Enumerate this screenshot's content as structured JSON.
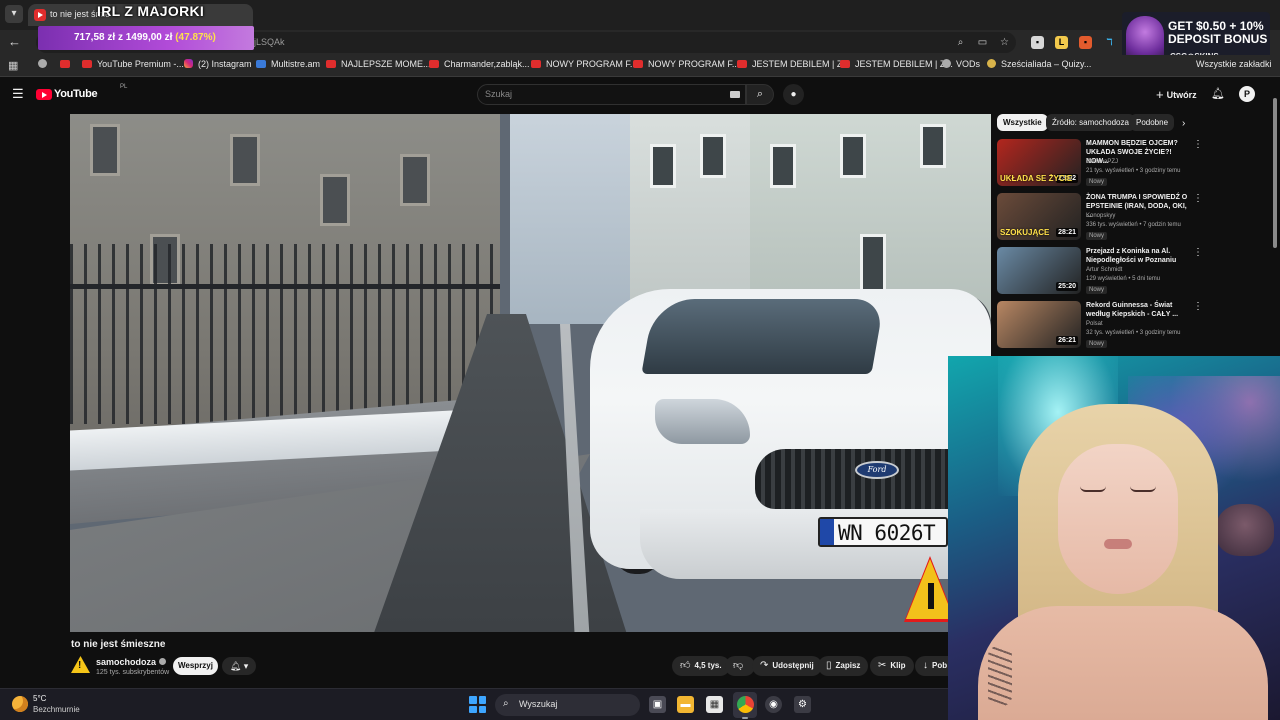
{
  "browser": {
    "tab_title": "to nie jest śmie",
    "url": "jLSQAk",
    "bookmarks": [
      {
        "label": "",
        "icon": "youtube-icon"
      },
      {
        "label": "YouTube Premium -...",
        "icon": "youtube-icon"
      },
      {
        "label": "(2) Instagram",
        "icon": "instagram-icon"
      },
      {
        "label": "Multistre.am",
        "icon": "multistream-icon"
      },
      {
        "label": "NAJLEPSZE MOME...",
        "icon": "youtube-icon"
      },
      {
        "label": "Charmander,zabląk...",
        "icon": "youtube-icon"
      },
      {
        "label": "NOWY PROGRAM F...",
        "icon": "youtube-icon"
      },
      {
        "label": "NOWY PROGRAM F...",
        "icon": "youtube-icon"
      },
      {
        "label": "JESTEM DEBILEM | Z...",
        "icon": "youtube-icon"
      },
      {
        "label": "JESTEM DEBILEM | Z...",
        "icon": "youtube-icon"
      },
      {
        "label": "VODs",
        "icon": "chrome-icon"
      },
      {
        "label": "Sześcialiada – Quizy...",
        "icon": "user-icon"
      }
    ],
    "bookmarks_folder": "Wszystkie zakładki"
  },
  "stream_overlay": {
    "title": "IRL Z MAJORKI",
    "donation_amount": "717,58 zł",
    "donation_of": "z",
    "donation_goal": "1499,00 zł",
    "donation_percent": "(47.87%)",
    "promo_line1": "GET $0.50 + 10%",
    "promo_line2": "DEPOSIT BONUS",
    "promo_brand": "CSG◎SKINS"
  },
  "youtube": {
    "logo_text": "YouTube",
    "logo_country": "PL",
    "search_placeholder": "Szukaj",
    "create_label": "Utwórz",
    "avatar_letter": "P",
    "video_title": "to nie jest śmieszne",
    "plate_text": "WN 6026T",
    "channel_name": "samochodoza",
    "channel_subs": "125 tys. subskrybentów",
    "join_label": "Wesprzyj",
    "actions": {
      "likes": "4,5 tys.",
      "share": "Udostępnij",
      "save": "Zapisz",
      "clip": "Klip",
      "download": "Pob"
    },
    "chips": [
      "Wszystkie",
      "Źródło: samochodoza",
      "Podobne"
    ],
    "recommendations": [
      {
        "title": "MAMMON BĘDZIE OJCEM? UKŁADA SWOJE ŻYCIE?! NOW...",
        "channel": "SzklanaPZJ",
        "meta": "21 tys. wyświetleń • 3 godziny temu",
        "badge": "Nowy",
        "duration": "23:02",
        "thumb_text": "UKŁADA SE ŻYCIE",
        "thumb_color": "#b3261e"
      },
      {
        "title": "ŻONA TRUMPA I SPOWIEDŹ O EPSTEINIE (IRAN, DODA, OKI, ...",
        "channel": "Konopskyy",
        "meta": "336 tys. wyświetleń • 7 godzin temu",
        "badge": "Nowy",
        "duration": "28:21",
        "thumb_text": "SZOKUJĄCE",
        "thumb_color": "#6b4b3a"
      },
      {
        "title": "Przejazd z Koninka na Al. Niepodległości w Poznaniu",
        "channel": "Artur Schmidt",
        "meta": "129 wyświetleń • 5 dni temu",
        "badge": "Nowy",
        "duration": "25:20",
        "thumb_text": "",
        "thumb_color": "#6a8aa5"
      },
      {
        "title": "Rekord Guinnessa - Świat według Kiepskich - CAŁY ...",
        "channel": "Polsat",
        "meta": "32 tys. wyświetleń • 3 godziny temu",
        "badge": "Nowy",
        "duration": "26:21",
        "thumb_text": "",
        "thumb_color": "#b88763"
      }
    ]
  },
  "taskbar": {
    "temperature": "5°C",
    "weather": "Bezchmurnie",
    "search_label": "Wyszukaj"
  }
}
